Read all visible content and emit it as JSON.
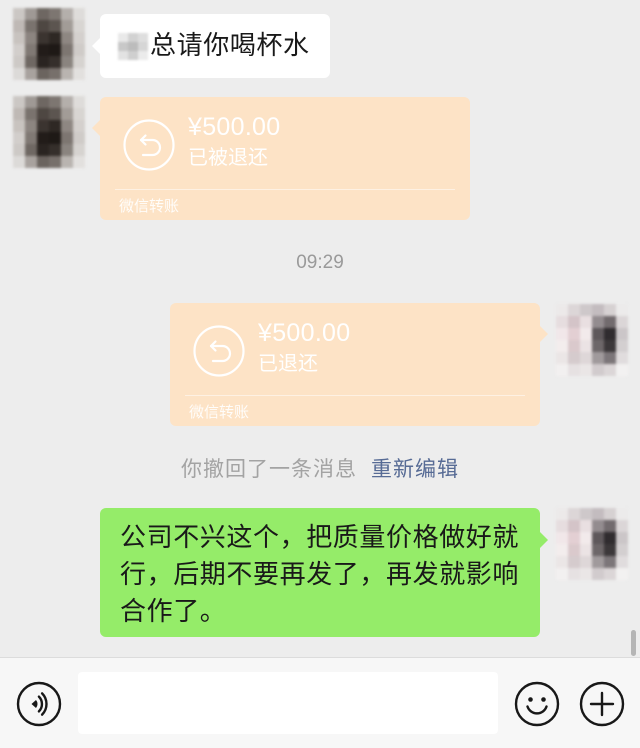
{
  "chat": {
    "messages": [
      {
        "text": "总请你喝杯水"
      },
      {
        "transfer": {
          "amount": "¥500.00",
          "status": "已被退还",
          "label": "微信转账"
        }
      },
      {
        "timestamp": "09:29"
      },
      {
        "transfer": {
          "amount": "¥500.00",
          "status": "已退还",
          "label": "微信转账"
        }
      },
      {
        "recall_notice": {
          "text": "你撤回了一条消息",
          "action": "重新编辑"
        }
      },
      {
        "text": "公司不兴这个，把质量价格做好就行，后期不要再发了，再发就影响合作了。"
      }
    ]
  },
  "input_bar": {
    "value": "",
    "icons": {
      "voice": "voice-icon",
      "emoji": "emoji-icon",
      "more": "plus-icon"
    }
  },
  "icons": {
    "transfer_returned": "return-arrow-icon"
  },
  "colors": {
    "chat_background": "#ededed",
    "incoming_bubble": "#ffffff",
    "outgoing_bubble": "#95ec69",
    "transfer_returned": "#fde3c6",
    "message_text": "#191919",
    "system_text": "#a3a3a3",
    "link": "#576b95",
    "toolbar_background": "#f7f7f7"
  }
}
